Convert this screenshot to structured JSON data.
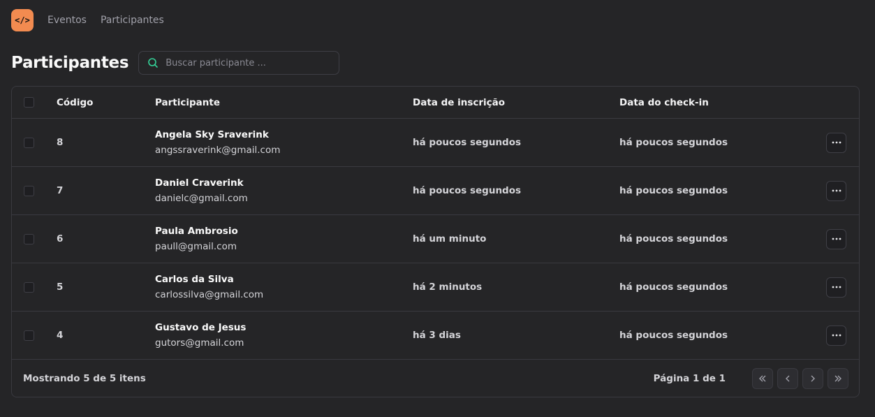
{
  "nav": {
    "logo_text": "</>",
    "links": [
      "Eventos",
      "Participantes"
    ]
  },
  "header": {
    "title": "Participantes",
    "search_placeholder": "Buscar participante ..."
  },
  "table": {
    "columns": [
      "Código",
      "Participante",
      "Data de inscrição",
      "Data do check-in"
    ],
    "rows": [
      {
        "code": "8",
        "name": "Angela Sky Sraverink",
        "email": "angssraverink@gmail.com",
        "signup": "há poucos segundos",
        "checkin": "há poucos segundos"
      },
      {
        "code": "7",
        "name": "Daniel Craverink",
        "email": "danielc@gmail.com",
        "signup": "há poucos segundos",
        "checkin": "há poucos segundos"
      },
      {
        "code": "6",
        "name": "Paula Ambrosio",
        "email": "paull@gmail.com",
        "signup": "há um minuto",
        "checkin": "há poucos segundos"
      },
      {
        "code": "5",
        "name": "Carlos da Silva",
        "email": "carlossilva@gmail.com",
        "signup": "há 2 minutos",
        "checkin": "há poucos segundos"
      },
      {
        "code": "4",
        "name": "Gustavo de Jesus",
        "email": "gutors@gmail.com",
        "signup": "há 3 dias",
        "checkin": "há poucos segundos"
      }
    ]
  },
  "footer": {
    "showing": "Mostrando 5 de 5 itens",
    "page": "Página 1 de 1"
  },
  "colors": {
    "background": "#252527",
    "accent": "#f28b50",
    "search_icon": "#34d399"
  },
  "icons": {
    "search": "search-icon",
    "more": "ellipsis-icon",
    "pagination": [
      "chevrons-left-icon",
      "chevron-left-icon",
      "chevron-right-icon",
      "chevrons-right-icon"
    ]
  }
}
